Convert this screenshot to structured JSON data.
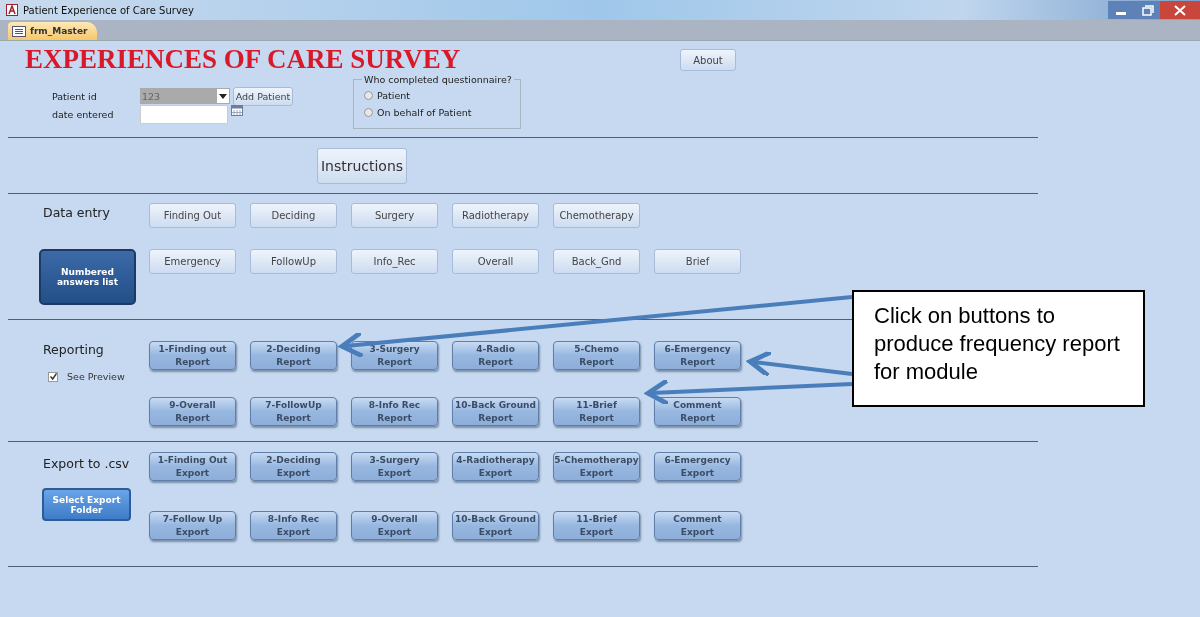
{
  "window": {
    "title": "Patient Experience of Care Survey"
  },
  "tab": {
    "label": "frm_Master",
    "selected": true
  },
  "form": {
    "title": "EXPERIENCES OF CARE SURVEY",
    "about_button": "About",
    "fields": [
      {
        "label": "Patient id",
        "kind": "combo",
        "value": "123"
      },
      {
        "label": "date entered",
        "kind": "date"
      }
    ],
    "add_patient_button": "Add Patient",
    "respondent": {
      "legend": "Who completed questionnaire?",
      "options": [
        {
          "label": "Patient",
          "selected": false
        },
        {
          "label": "On behalf of Patient",
          "selected": false
        }
      ]
    },
    "instructions_button": "Instructions",
    "sections": [
      {
        "label": "Data entry",
        "kind": "entry",
        "side_button": "Numbered answers list",
        "rows": [
          [
            "Finding Out",
            "Deciding",
            "Surgery",
            "Radiotherapy",
            "Chemotherapy"
          ],
          [
            "Emergency",
            "FollowUp",
            "Info_Rec",
            "Overall",
            "Back_Gnd",
            "Brief"
          ]
        ]
      },
      {
        "label": "Reporting",
        "kind": "report",
        "checkbox": {
          "label": "See Preview",
          "checked": true
        },
        "rows": [
          [
            "1-Finding out\nReport",
            "2-Deciding\nReport",
            "3-Surgery\nReport",
            "4-Radio\nReport",
            "5-Chemo\nReport",
            "6-Emergency\nReport"
          ],
          [
            "9-Overall\nReport",
            "7-FollowUp\nReport",
            "8-Info Rec\nReport",
            "10-Back Ground\nReport",
            "11-Brief\nReport",
            "Comment\nReport"
          ]
        ]
      },
      {
        "label": "Export to .csv",
        "kind": "export",
        "side_button": "Select Export Folder",
        "rows": [
          [
            "1-Finding Out\nExport",
            "2-Deciding\nExport",
            "3-Surgery\nExport",
            "4-Radiotherapy\nExport",
            "5-Chemotherapy\nExport",
            "6-Emergency\nExport"
          ],
          [
            "7-Follow Up\nExport",
            "8-Info Rec\nExport",
            "9-Overall\nExport",
            "10-Back Ground\nExport",
            "11-Brief\nExport",
            "Comment\nExport"
          ]
        ]
      }
    ]
  },
  "callout": {
    "text": "Click on buttons to produce frequency report for module"
  }
}
